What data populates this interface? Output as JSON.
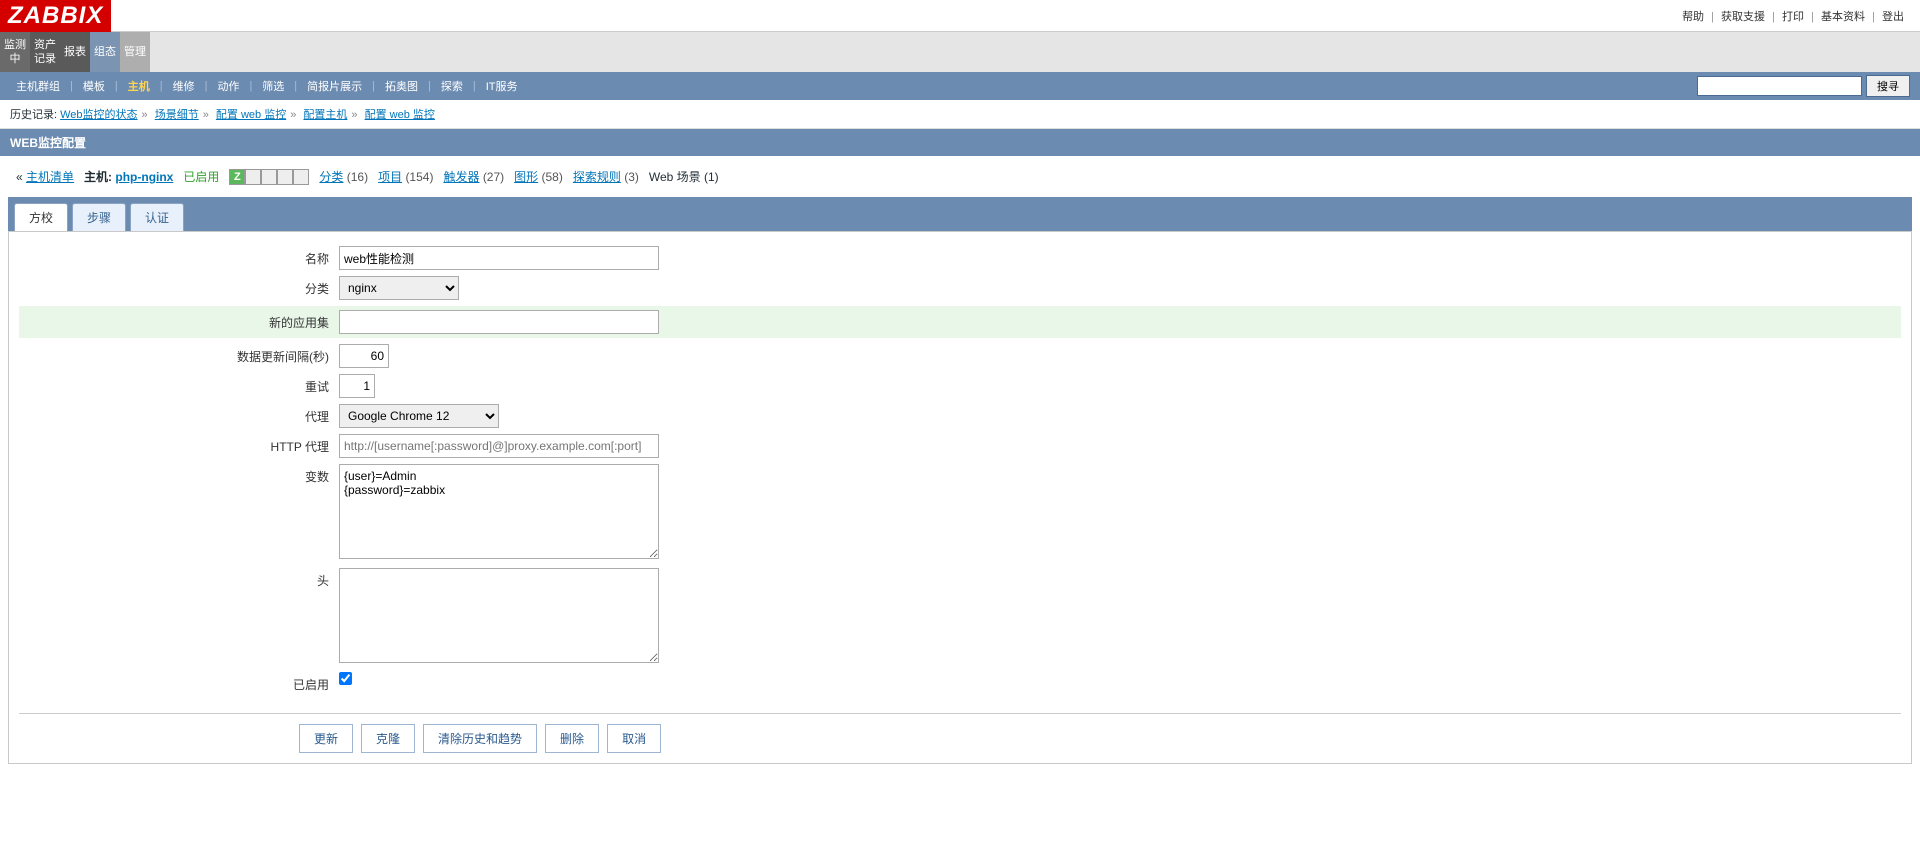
{
  "topLinks": {
    "help": "帮助",
    "support": "获取支援",
    "print": "打印",
    "profile": "基本资料",
    "logout": "登出",
    "sep": "|"
  },
  "logo": "ZABBIX",
  "mainNav": {
    "items": [
      "监测中",
      "资产记录",
      "报表",
      "组态",
      "管理"
    ]
  },
  "subNav": {
    "items": [
      "主机群组",
      "模板",
      "主机",
      "维修",
      "动作",
      "筛选",
      "简报片展示",
      "拓奥图",
      "探索",
      "IT服务"
    ],
    "searchBtn": "搜寻"
  },
  "history": {
    "label": "历史记录:",
    "items": [
      "Web监控的状态",
      "场景细节",
      "配置 web 监控",
      "配置主机",
      "配置 web 监控"
    ]
  },
  "pageTitle": "WEB监控配置",
  "context": {
    "backLink": "主机清单",
    "hostLabel": "主机:",
    "hostLink": "php-nginx",
    "enabled": "已启用",
    "statusZ": "Z",
    "links": [
      {
        "label": "分类",
        "count": "(16)"
      },
      {
        "label": "项目",
        "count": "(154)"
      },
      {
        "label": "触发器",
        "count": "(27)"
      },
      {
        "label": "图形",
        "count": "(58)"
      },
      {
        "label": "探索规则",
        "count": "(3)"
      }
    ],
    "webScenario": "Web 场景 (1)"
  },
  "tabs": [
    "方校",
    "步骤",
    "认证"
  ],
  "form": {
    "nameLabel": "名称",
    "nameValue": "web性能检测",
    "categoryLabel": "分类",
    "categoryValue": "nginx",
    "newAppLabel": "新的应用集",
    "newAppValue": "",
    "intervalLabel": "数据更新间隔(秒)",
    "intervalValue": "60",
    "retryLabel": "重试",
    "retryValue": "1",
    "agentLabel": "代理",
    "agentValue": "Google Chrome 12",
    "httpProxyLabel": "HTTP 代理",
    "httpProxyPlaceholder": "http://[username[:password]@]proxy.example.com[:port]",
    "varsLabel": "变数",
    "varsValue": "{user}=Admin\n{password}=zabbix",
    "headersLabel": "头",
    "headersValue": "",
    "enabledLabel": "已启用"
  },
  "actions": {
    "update": "更新",
    "clone": "克隆",
    "clearHist": "清除历史和趋势",
    "delete": "删除",
    "cancel": "取消"
  }
}
